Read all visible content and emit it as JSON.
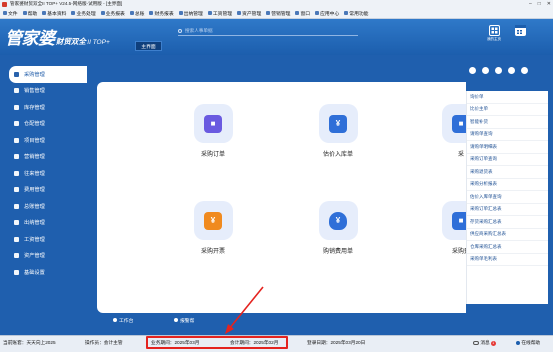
{
  "window": {
    "title": "管家婆财贸双全II TOP+ V24.5-网络版-试用版 - [主界面]"
  },
  "menu": [
    "文件",
    "帮助",
    "基本资料",
    "业务处理",
    "业务报表",
    "总账",
    "财务报表",
    "出纳管理",
    "工资管理",
    "资产管理",
    "营销管理",
    "窗口",
    "应用中心",
    "常用功能"
  ],
  "brand": {
    "main": "管家婆",
    "sub": "财贸双全",
    "version": "II TOP+"
  },
  "search": {
    "placeholder": "搜索人事单据"
  },
  "main_tab": "主界面",
  "top_right": [
    {
      "label": "我的主页",
      "icon": "home-grid-icon"
    },
    {
      "label": "",
      "icon": "calendar-icon"
    }
  ],
  "sidebar": {
    "items": [
      {
        "label": "采购管理",
        "icon": "cart-icon",
        "active": true
      },
      {
        "label": "销售管理",
        "icon": "bar-chart-icon"
      },
      {
        "label": "库存管理",
        "icon": "box-icon"
      },
      {
        "label": "仓配管理",
        "icon": "warehouse-icon"
      },
      {
        "label": "项目管理",
        "icon": "project-icon"
      },
      {
        "label": "营销管理",
        "icon": "tag-icon"
      },
      {
        "label": "往来管理",
        "icon": "exchange-icon"
      },
      {
        "label": "费用管理",
        "icon": "money-bag-icon"
      },
      {
        "label": "总账管理",
        "icon": "ledger-icon"
      },
      {
        "label": "出纳管理",
        "icon": "cashier-icon"
      },
      {
        "label": "工资管理",
        "icon": "salary-icon"
      },
      {
        "label": "资产管理",
        "icon": "asset-icon"
      },
      {
        "label": "基础设置",
        "icon": "settings-icon"
      }
    ]
  },
  "tiles": [
    {
      "label": "采购订单",
      "icon": "order-doc-icon",
      "color": "#6a5ae0"
    },
    {
      "label": "估价入库单",
      "icon": "yen-house-icon",
      "color": "#2f6fd8"
    },
    {
      "label": "采",
      "icon": "doc-icon",
      "color": "#2f6fd8"
    },
    {
      "label": "采购开票",
      "icon": "ticket-icon",
      "color": "#f08a1f"
    },
    {
      "label": "购销费用单",
      "icon": "money-bag-icon",
      "color": "#2f6fd8"
    },
    {
      "label": "采购费",
      "icon": "doc-icon",
      "color": "#2f6fd8"
    }
  ],
  "side_list": [
    "询价单",
    "比价主单",
    "智能补货",
    "请购单查询",
    "请购单明细表",
    "采购订单查询",
    "采购退货表",
    "采购分析报表",
    "估价入库单查询",
    "采购订单汇总表",
    "存货采购汇总表",
    "供应商采购汇总表",
    "仓库采购汇总表",
    "采购单毛利表"
  ],
  "bottom_tabs": [
    "工作台",
    "报警帮"
  ],
  "status": {
    "book": "当前账套：天天向上2025",
    "operator": "操作员：会计主管",
    "business_period": "业务期间：2025年03月",
    "accounting_period": "会计期间：2025年02月",
    "login_date": "登录日期：2025年03月20日",
    "messages": "消息",
    "message_count": "1",
    "online_help": "在线帮助"
  }
}
